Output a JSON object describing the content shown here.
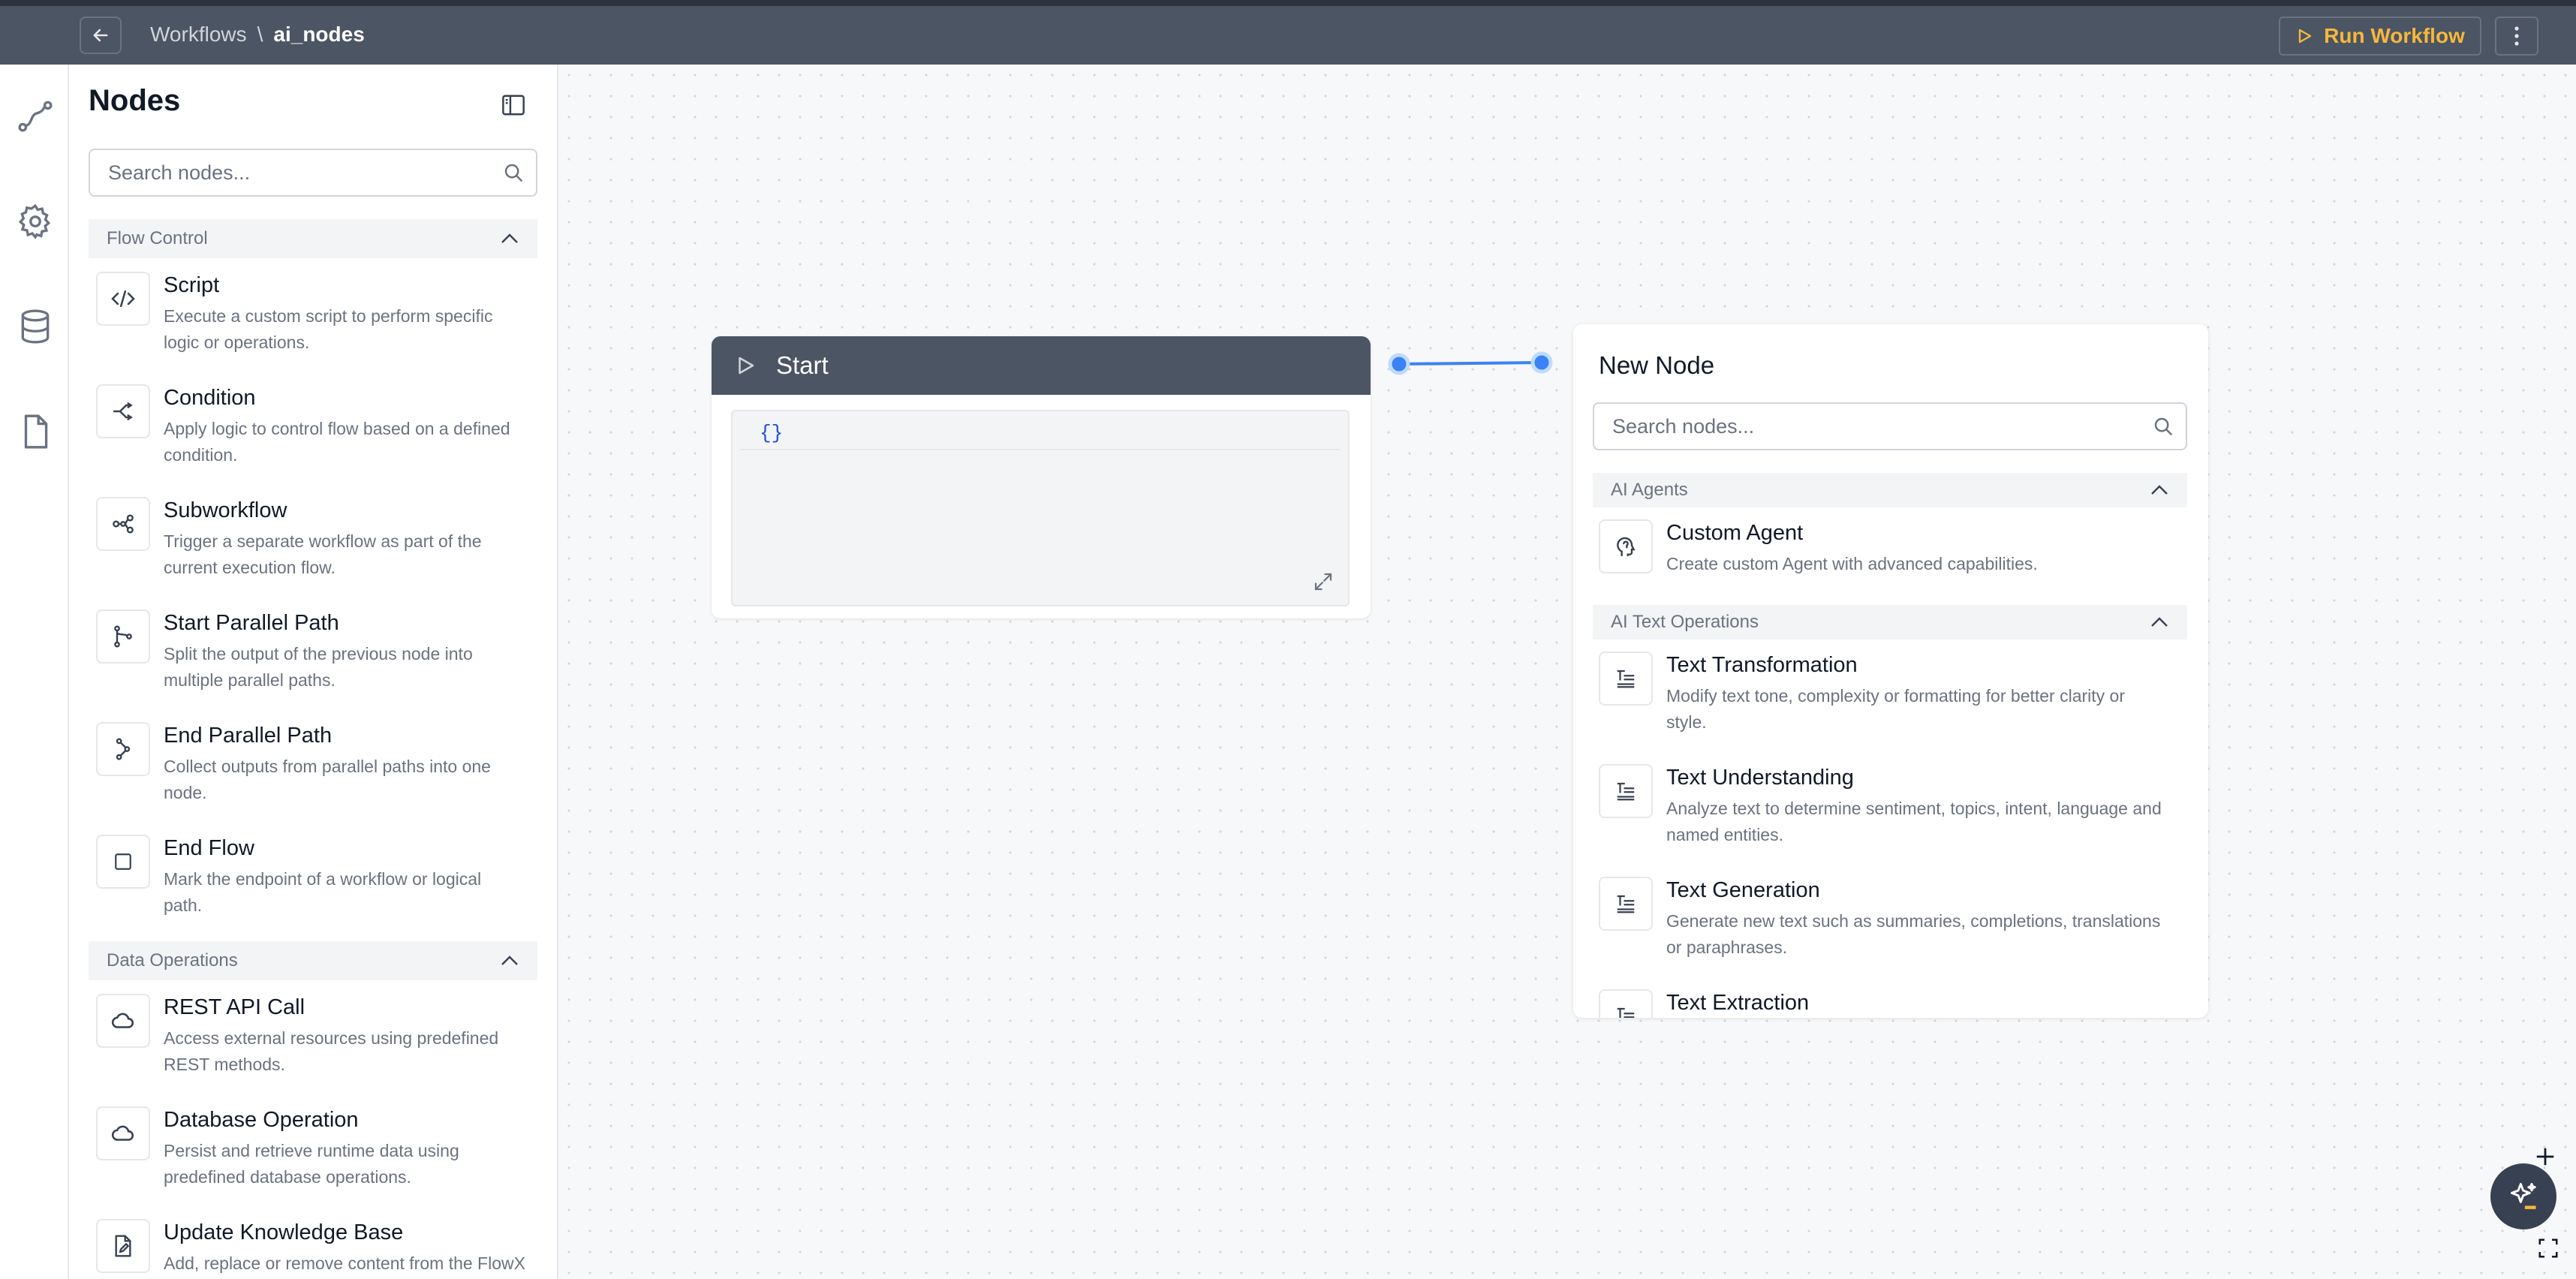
{
  "topbar": {
    "breadcrumb_root": "Workflows",
    "breadcrumb_sep": "\\",
    "breadcrumb_current": "ai_nodes",
    "run_label": "Run Workflow"
  },
  "rail": {
    "icons": [
      "workflow-icon",
      "gear-icon",
      "database-icon",
      "document-icon"
    ]
  },
  "panel": {
    "title": "Nodes",
    "search_placeholder": "Search nodes...",
    "sections": [
      {
        "label": "Flow Control",
        "items": [
          {
            "title": "Script",
            "desc1": "Execute a custom script to perform specific",
            "desc2": "logic or operations."
          },
          {
            "title": "Condition",
            "desc1": "Apply logic to control flow based on a defined",
            "desc2": "condition."
          },
          {
            "title": "Subworkflow",
            "desc1": "Trigger a separate workflow as part of the",
            "desc2": "current execution flow."
          },
          {
            "title": "Start Parallel Path",
            "desc1": "Split the output of the previous node into",
            "desc2": "multiple parallel paths."
          },
          {
            "title": "End Parallel Path",
            "desc1": "Collect outputs from parallel paths into one",
            "desc2": "node."
          },
          {
            "title": "End Flow",
            "desc1": "Mark the endpoint of a workflow or logical",
            "desc2": "path."
          }
        ]
      },
      {
        "label": "Data Operations",
        "items": [
          {
            "title": "REST API Call",
            "desc1": "Access external resources using predefined",
            "desc2": "REST methods."
          },
          {
            "title": "Database Operation",
            "desc1": "Persist and retrieve runtime data using",
            "desc2": "predefined database operations."
          },
          {
            "title": "Update Knowledge Base",
            "desc1": "Add, replace or remove content from the FlowX",
            "desc2": ""
          }
        ]
      }
    ]
  },
  "start_node": {
    "title": "Start",
    "code": "{}"
  },
  "new_node": {
    "title": "New Node",
    "search_placeholder": "Search nodes...",
    "sections": [
      {
        "label": "AI Agents",
        "items": [
          {
            "title": "Custom Agent",
            "desc1": "Create custom Agent with advanced capabilities.",
            "desc2": ""
          }
        ]
      },
      {
        "label": "AI Text Operations",
        "items": [
          {
            "title": "Text Transformation",
            "desc1": "Modify text tone, complexity or formatting for better clarity or",
            "desc2": "style."
          },
          {
            "title": "Text Understanding",
            "desc1": "Analyze text to determine sentiment, topics, intent, language and",
            "desc2": "named entities."
          },
          {
            "title": "Text Generation",
            "desc1": "Generate new text such as summaries, completions, translations",
            "desc2": "or paraphrases."
          },
          {
            "title": "Text Extraction",
            "desc1": "",
            "desc2": ""
          }
        ]
      }
    ]
  },
  "colors": {
    "topbar": "#4b5563",
    "accent": "#f6b73c",
    "connector": "#3b82f6"
  }
}
